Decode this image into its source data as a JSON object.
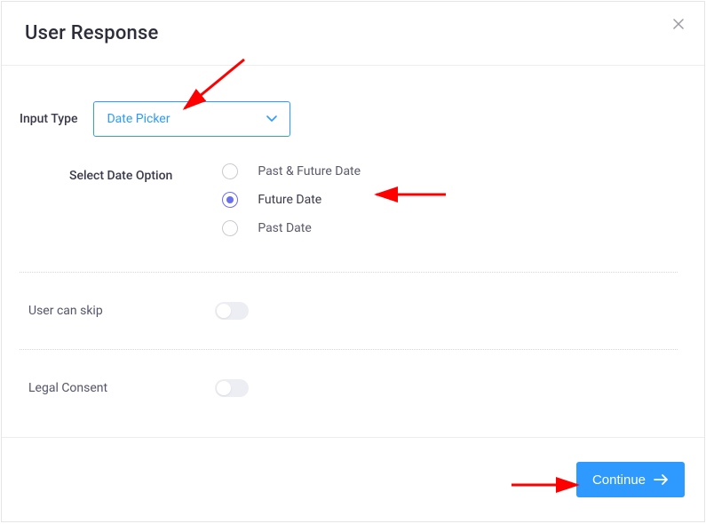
{
  "header": {
    "title": "User Response"
  },
  "inputType": {
    "label": "Input Type",
    "selected": "Date Picker"
  },
  "dateOption": {
    "label": "Select Date Option",
    "options": [
      {
        "label": "Past & Future Date",
        "selected": false
      },
      {
        "label": "Future Date",
        "selected": true
      },
      {
        "label": "Past Date",
        "selected": false
      }
    ]
  },
  "toggles": {
    "skip": {
      "label": "User can skip",
      "on": false
    },
    "legal": {
      "label": "Legal Consent",
      "on": false
    }
  },
  "footer": {
    "continue": "Continue"
  }
}
